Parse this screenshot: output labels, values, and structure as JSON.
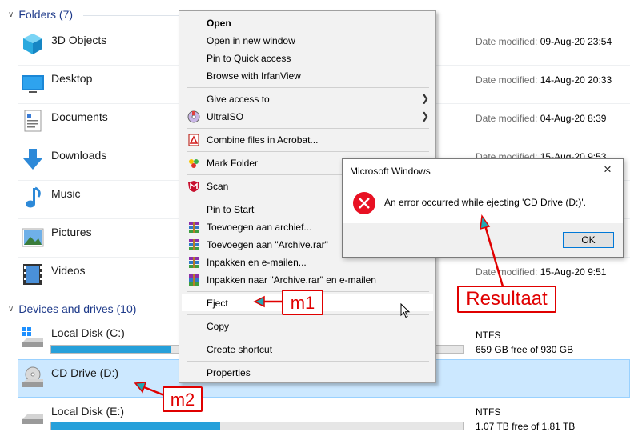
{
  "folders": {
    "header": "Folders (7)",
    "items": [
      {
        "name": "3D Objects",
        "modified_label": "Date modified:",
        "modified": "09-Aug-20 23:54"
      },
      {
        "name": "Desktop",
        "modified_label": "Date modified:",
        "modified": "14-Aug-20 20:33"
      },
      {
        "name": "Documents",
        "modified_label": "Date modified:",
        "modified": "04-Aug-20 8:39"
      },
      {
        "name": "Downloads",
        "modified_label": "Date modified:",
        "modified": "15-Aug-20 9:53"
      },
      {
        "name": "Music"
      },
      {
        "name": "Pictures"
      },
      {
        "name": "Videos",
        "modified_label": "Date modified:",
        "modified": "15-Aug-20 9:51"
      }
    ]
  },
  "drives": {
    "header": "Devices and drives (10)",
    "items": [
      {
        "name": "Local Disk (C:)",
        "fs": "NTFS",
        "free": "659 GB free of 930 GB",
        "used_fraction": 0.29
      },
      {
        "name": "CD Drive (D:)"
      },
      {
        "name": "Local Disk (E:)",
        "fs": "NTFS",
        "free": "1.07 TB free of 1.81 TB",
        "used_fraction": 0.41
      }
    ]
  },
  "context_menu": {
    "open": "Open",
    "open_new_window": "Open in new window",
    "pin_quick": "Pin to Quick access",
    "browse_irfan": "Browse with IrfanView",
    "give_access": "Give access to",
    "ultraiso": "UltraISO",
    "combine": "Combine files in Acrobat...",
    "mark_folder": "Mark Folder",
    "scan": "Scan",
    "pin_start": "Pin to Start",
    "add_archive": "Toevoegen aan archief...",
    "add_archive_rar": "Toevoegen aan \"Archive.rar\"",
    "pack_email": "Inpakken en e-mailen...",
    "pack_rar_email": "Inpakken naar \"Archive.rar\" en e-mailen",
    "eject": "Eject",
    "copy": "Copy",
    "create_shortcut": "Create shortcut",
    "properties": "Properties"
  },
  "dialog": {
    "title": "Microsoft Windows",
    "close": "×",
    "message": "An error occurred while ejecting 'CD Drive (D:)'.",
    "ok": "OK"
  },
  "annotations": {
    "m1": "m1",
    "m2": "m2",
    "result": "Resultaat"
  },
  "colors": {
    "annotation": "#e00000",
    "selection": "#cce8ff",
    "drive_fill": "#26a0da",
    "error": "#e81123"
  }
}
